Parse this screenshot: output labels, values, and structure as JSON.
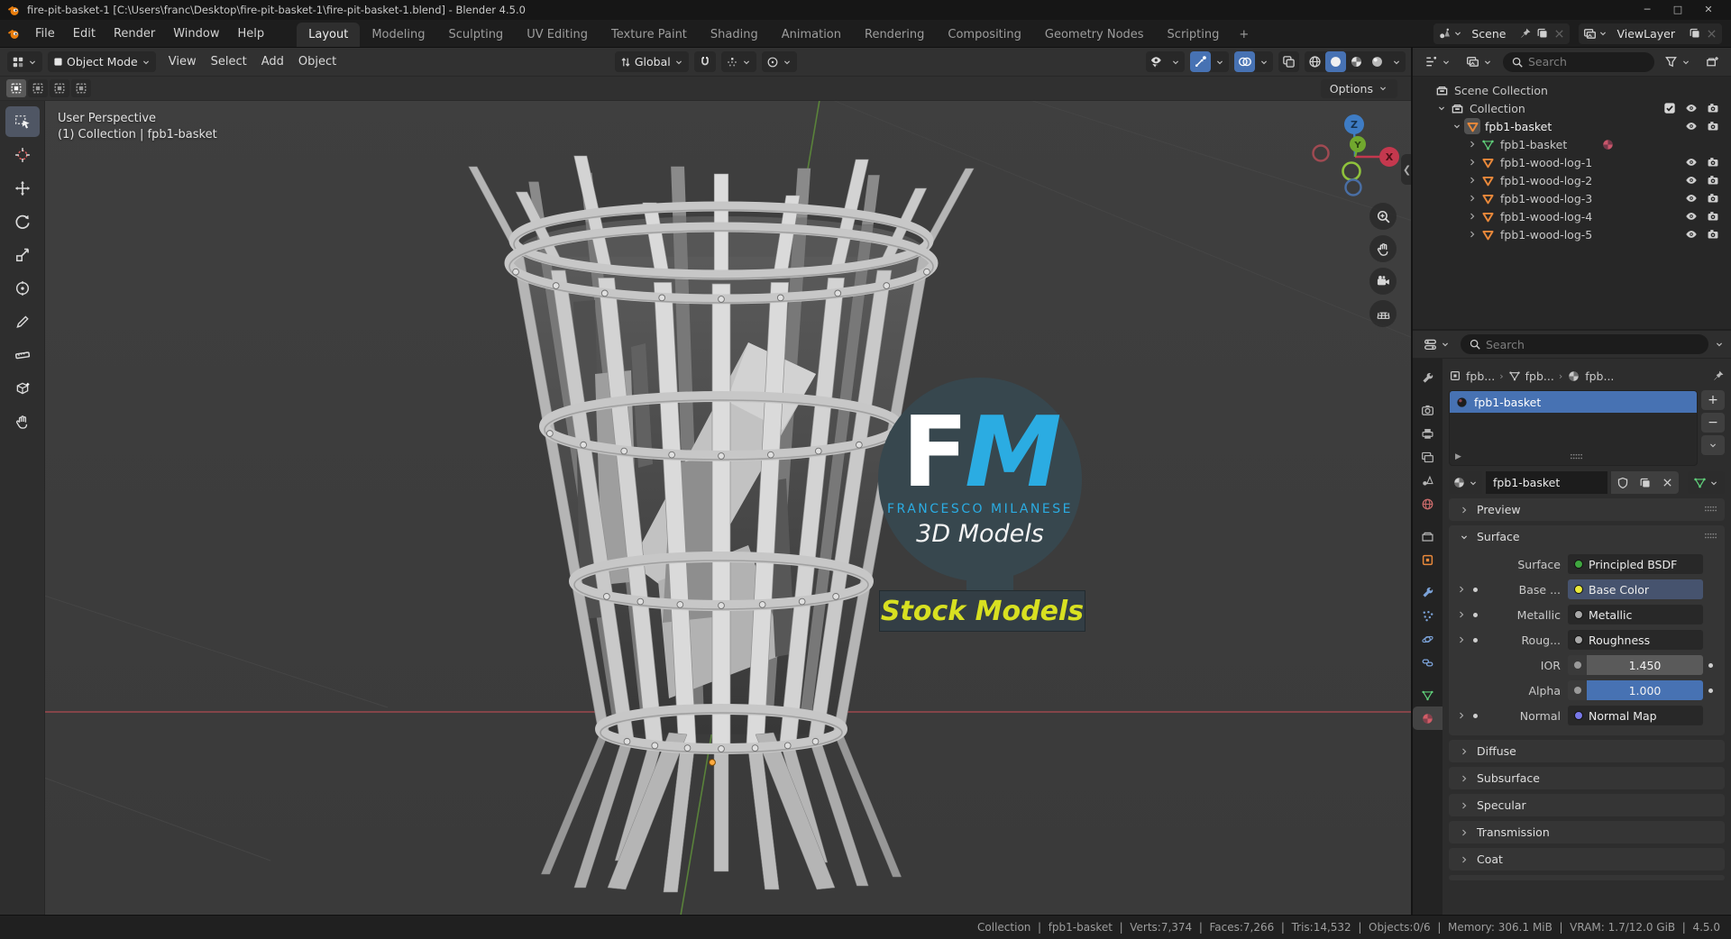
{
  "window": {
    "title": "fire-pit-basket-1 [C:\\Users\\franc\\Desktop\\fire-pit-basket-1\\fire-pit-basket-1.blend] - Blender 4.5.0"
  },
  "topbar": {
    "menus": [
      "File",
      "Edit",
      "Render",
      "Window",
      "Help"
    ],
    "tabs": [
      "Layout",
      "Modeling",
      "Sculpting",
      "UV Editing",
      "Texture Paint",
      "Shading",
      "Animation",
      "Rendering",
      "Compositing",
      "Geometry Nodes",
      "Scripting"
    ],
    "active_tab": "Layout",
    "add_workspace": "+",
    "scene_label": "Scene",
    "viewlayer_label": "ViewLayer"
  },
  "viewport_header": {
    "mode": "Object Mode",
    "menus": [
      "View",
      "Select",
      "Add",
      "Object"
    ],
    "orientation": "Global",
    "right_toggles": [
      {
        "icon": "visibility",
        "chev": true,
        "active": false
      },
      {
        "icon": "gizmos",
        "chev": true,
        "active": true
      },
      {
        "icon": "overlays",
        "chev": true,
        "active": true
      },
      {
        "icon": "xray",
        "chev": false,
        "active": false
      }
    ],
    "shading_modes": [
      {
        "icon": "wireframe",
        "active": false
      },
      {
        "icon": "solid",
        "active": true
      },
      {
        "icon": "material-preview",
        "active": false
      },
      {
        "icon": "rendered",
        "active": false
      }
    ]
  },
  "tool_settings": {
    "select_modes": [
      "set",
      "extend",
      "subtract",
      "intersect"
    ],
    "active_mode": "set",
    "options_label": "Options"
  },
  "toolbar": {
    "tools": [
      {
        "name": "select-box",
        "active": true
      },
      {
        "name": "cursor",
        "active": false
      },
      {
        "name": "move",
        "active": false
      },
      {
        "name": "rotate",
        "active": false
      },
      {
        "name": "scale",
        "active": false
      },
      {
        "name": "transform",
        "active": false
      },
      {
        "name": "annotate",
        "active": false
      },
      {
        "name": "measure",
        "active": false
      },
      {
        "name": "add-cube",
        "active": false
      },
      {
        "name": "interact",
        "active": false
      }
    ]
  },
  "viewport": {
    "overlay_line1": "User Perspective",
    "overlay_line2": "(1) Collection | fpb1-basket",
    "gizmo_axes": {
      "x": "X",
      "y": "Y",
      "z": "Z"
    }
  },
  "badge": {
    "initial_f": "F",
    "initial_m": "M",
    "subtitle": "FRANCESCO MILANESE",
    "line2": "3D Models",
    "banner": "Stock Models"
  },
  "outliner": {
    "search_placeholder": "Search",
    "rows": [
      {
        "label": "Scene Collection",
        "icon": "collection",
        "depth": 0,
        "expander": "none",
        "check": false,
        "eye": false,
        "cam": false,
        "active": false,
        "matdot": false
      },
      {
        "label": "Collection",
        "icon": "collection",
        "depth": 1,
        "expander": "open",
        "check": true,
        "eye": true,
        "cam": true,
        "active": false,
        "matdot": false
      },
      {
        "label": "fpb1-basket",
        "icon": "mesh-object",
        "depth": 2,
        "expander": "open",
        "check": false,
        "eye": true,
        "cam": true,
        "active": true,
        "matdot": false
      },
      {
        "label": "fpb1-basket",
        "icon": "mesh-data",
        "depth": 3,
        "expander": "closed",
        "check": false,
        "eye": false,
        "cam": false,
        "active": false,
        "matdot": true
      },
      {
        "label": "fpb1-wood-log-1",
        "icon": "mesh-object",
        "depth": 3,
        "expander": "closed",
        "check": false,
        "eye": true,
        "cam": true,
        "active": false,
        "matdot": false
      },
      {
        "label": "fpb1-wood-log-2",
        "icon": "mesh-object",
        "depth": 3,
        "expander": "closed",
        "check": false,
        "eye": true,
        "cam": true,
        "active": false,
        "matdot": false
      },
      {
        "label": "fpb1-wood-log-3",
        "icon": "mesh-object",
        "depth": 3,
        "expander": "closed",
        "check": false,
        "eye": true,
        "cam": true,
        "active": false,
        "matdot": false
      },
      {
        "label": "fpb1-wood-log-4",
        "icon": "mesh-object",
        "depth": 3,
        "expander": "closed",
        "check": false,
        "eye": true,
        "cam": true,
        "active": false,
        "matdot": false
      },
      {
        "label": "fpb1-wood-log-5",
        "icon": "mesh-object",
        "depth": 3,
        "expander": "closed",
        "check": false,
        "eye": true,
        "cam": true,
        "active": false,
        "matdot": false
      }
    ]
  },
  "properties": {
    "search_placeholder": "Search",
    "tabs": [
      {
        "name": "tool",
        "active": false,
        "gap": false
      },
      {
        "name": "render",
        "active": false,
        "gap": true
      },
      {
        "name": "output",
        "active": false,
        "gap": false
      },
      {
        "name": "view-layer",
        "active": false,
        "gap": false
      },
      {
        "name": "scene",
        "active": false,
        "gap": false
      },
      {
        "name": "world",
        "active": false,
        "gap": false
      },
      {
        "name": "collection",
        "active": false,
        "gap": true
      },
      {
        "name": "object",
        "active": false,
        "gap": false
      },
      {
        "name": "modifiers",
        "active": false,
        "gap": true
      },
      {
        "name": "particles",
        "active": false,
        "gap": false
      },
      {
        "name": "physics",
        "active": false,
        "gap": false
      },
      {
        "name": "constraints",
        "active": false,
        "gap": false
      },
      {
        "name": "data",
        "active": false,
        "gap": true
      },
      {
        "name": "material",
        "active": true,
        "gap": false
      }
    ],
    "breadcrumb": [
      "fpb...",
      "fpb...",
      "fpb..."
    ],
    "slot_name": "fpb1-basket",
    "material_name": "fpb1-basket",
    "panels": {
      "preview_label": "Preview",
      "surface_label": "Surface"
    },
    "surface": {
      "rows": [
        {
          "label": "Surface",
          "value": "Principled BSDF",
          "field": "menu",
          "socket": "#3fa63f",
          "expand": false,
          "key": false,
          "highlight": false,
          "after_dot": false
        },
        {
          "label": "Base ...",
          "value": "Base Color",
          "field": "menu",
          "socket": "#e9e93a",
          "expand": true,
          "key": true,
          "highlight": true,
          "after_dot": false
        },
        {
          "label": "Metallic",
          "value": "Metallic",
          "field": "menu",
          "socket": "#a8a8a8",
          "expand": true,
          "key": true,
          "highlight": false,
          "after_dot": false
        },
        {
          "label": "Roug...",
          "value": "Roughness",
          "field": "menu",
          "socket": "#a8a8a8",
          "expand": true,
          "key": true,
          "highlight": false,
          "after_dot": false
        },
        {
          "label": "IOR",
          "value": "1.450",
          "field": "slider",
          "slider_color": "#5a5a5a",
          "expand": false,
          "key": false,
          "highlight": false,
          "after_dot": true
        },
        {
          "label": "Alpha",
          "value": "1.000",
          "field": "slider",
          "slider_color": "#4772b3",
          "expand": false,
          "key": false,
          "highlight": false,
          "after_dot": true
        },
        {
          "label": "Normal",
          "value": "Normal Map",
          "field": "menu",
          "socket": "#7878e8",
          "expand": true,
          "key": true,
          "highlight": false,
          "after_dot": false
        }
      ]
    },
    "collapsed_panels": [
      "Diffuse",
      "Subsurface",
      "Specular",
      "Transmission",
      "Coat"
    ]
  },
  "statusbar": {
    "segments": [
      "Collection",
      "fpb1-basket",
      "Verts:7,374",
      "Faces:7,266",
      "Tris:14,532",
      "Objects:0/6",
      "Memory: 306.1 MiB",
      "VRAM: 1.7/12.0 GiB",
      "4.5.0"
    ]
  },
  "colors": {
    "accent_blue": "#4772b3",
    "object_orange": "#e8883a",
    "mesh_green": "#5fcf7a",
    "axis_x": "#c4384e",
    "axis_y": "#71a82e",
    "axis_z": "#3e7cc4",
    "badge_bg": "#37474e",
    "badge_cyan": "#2bace2",
    "banner_yellow": "#d8e021"
  }
}
